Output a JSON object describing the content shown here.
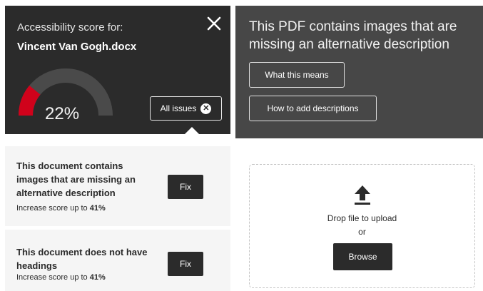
{
  "score_panel": {
    "caption": "Accessibility score for:",
    "document_name": "Vincent Van Gogh.docx",
    "score_value": 0.22,
    "score_label": "22%",
    "all_issues_label": "All issues",
    "close_icon": "close-icon",
    "clear_icon": "x-circle-icon"
  },
  "pdf_message": {
    "title": "This PDF contains images that are missing an alternative description",
    "what_means_label": "What this means",
    "how_to_label": "How to add descriptions"
  },
  "issues": [
    {
      "text": "This document contains images that are missing an alternative description",
      "score_prefix": "Increase score up to ",
      "score_value": "41%",
      "fix_label": "Fix"
    },
    {
      "text": "This document does not have headings",
      "score_prefix": "Increase score up to ",
      "score_value": "41%",
      "fix_label": "Fix"
    }
  ],
  "dropzone": {
    "drop_text": "Drop file to upload",
    "or_text": "or",
    "browse_label": "Browse",
    "icon": "upload-icon"
  },
  "colors": {
    "dark_panel": "#2b2b2b",
    "mid_panel": "#474747",
    "gauge_track": "#4a4a4a",
    "gauge_fill": "#d0021b",
    "issue_bg": "#f5f5f5"
  }
}
